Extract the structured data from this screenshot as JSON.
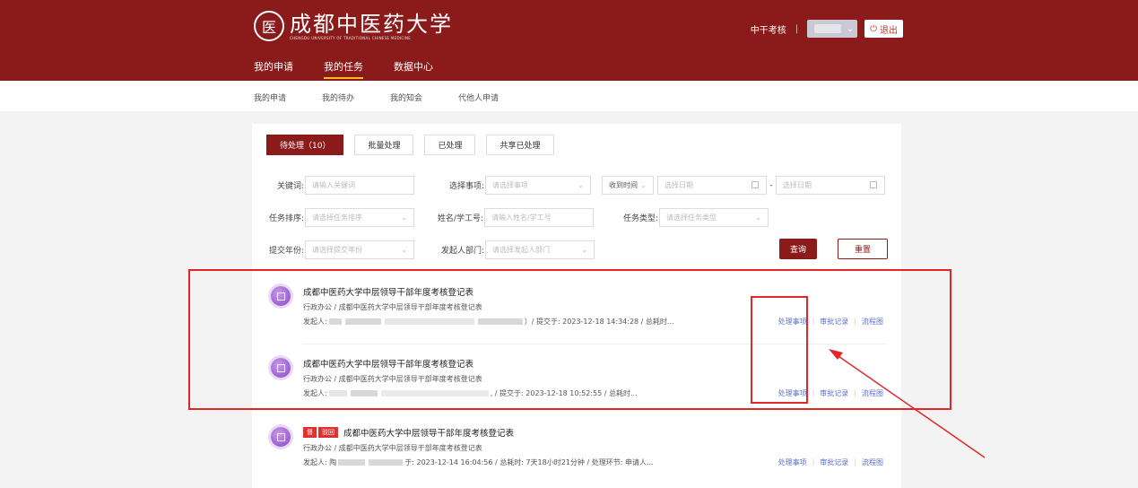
{
  "header": {
    "logo_cn": "成都中医药大学",
    "logo_en": "CHENGDU UNIVERSITY OF TRADITIONAL CHINESE MEDICINE",
    "emblem_glyph": "医",
    "role_label": "中干考核",
    "separator": "|",
    "user_dropdown_icon": "chevron-down-icon",
    "logout_label": "退出",
    "logout_icon": "power-icon"
  },
  "main_nav": {
    "items": [
      {
        "label": "我的申请"
      },
      {
        "label": "我的任务"
      },
      {
        "label": "数据中心"
      }
    ],
    "active_index": 1
  },
  "sub_nav": {
    "items": [
      {
        "label": "我的申请"
      },
      {
        "label": "我的待办"
      },
      {
        "label": "我的知会"
      },
      {
        "label": "代他人申请"
      }
    ]
  },
  "tabs": [
    {
      "label": "待处理（10）"
    },
    {
      "label": "批量处理"
    },
    {
      "label": "已处理"
    },
    {
      "label": "共享已处理"
    }
  ],
  "filters": {
    "keyword": {
      "label": "关键词:",
      "placeholder": "请输入关键词"
    },
    "item_select": {
      "label": "选择事项:",
      "placeholder": "请选择事项"
    },
    "time_select": {
      "label": "收到时间"
    },
    "date_start": {
      "placeholder": "选择日期"
    },
    "date_sep": "-",
    "date_end": {
      "placeholder": "选择日期"
    },
    "sort": {
      "label": "任务排序:",
      "placeholder": "请选择任务排序"
    },
    "name_id": {
      "label": "姓名/学工号:",
      "placeholder": "请输入姓名/学工号"
    },
    "task_type": {
      "label": "任务类型:",
      "placeholder": "请选择任务类型"
    },
    "year": {
      "label": "提交年份:",
      "placeholder": "请选择提交年份"
    },
    "dept": {
      "label": "发起人部门:",
      "placeholder": "请选择发起人部门"
    },
    "query_label": "查询",
    "reset_label": "重置"
  },
  "tasks": [
    {
      "title": "成都中医药大学中层领导干部年度考核登记表",
      "path": "行政办公 / 成都中医药大学中层领导干部年度考核登记表",
      "initiator_label": "发起人:",
      "meta_tail": "）/ 提交于: 2023-12-18 14:34:28 / 总耗时...",
      "actions": [
        "处理事项",
        "审批记录",
        "流程图"
      ]
    },
    {
      "title": "成都中医药大学中层领导干部年度考核登记表",
      "path": "行政办公 / 成都中医药大学中层领导干部年度考核登记表",
      "initiator_label": "发起人:",
      "meta_tail": ", / 提交于: 2023-12-18 10:52:55 / 总耗时...",
      "actions": [
        "处理事项",
        "审批记录",
        "流程图"
      ]
    },
    {
      "badges": [
        "督",
        "驳回"
      ],
      "title": "成都中医药大学中层领导干部年度考核登记表",
      "path": "行政办公 / 成都中医药大学中层领导干部年度考核登记表",
      "initiator_label": "发起人: 陶",
      "meta_tail": "于: 2023-12-14 16:04:56 / 总耗时: 7天18小时21分钟 / 处理环节: 申请人...",
      "actions": [
        "处理事项",
        "审批记录",
        "流程图"
      ]
    }
  ],
  "colors": {
    "brand": "#8b1a1a",
    "highlight": "#e3262a",
    "link": "#5a6fd0"
  }
}
